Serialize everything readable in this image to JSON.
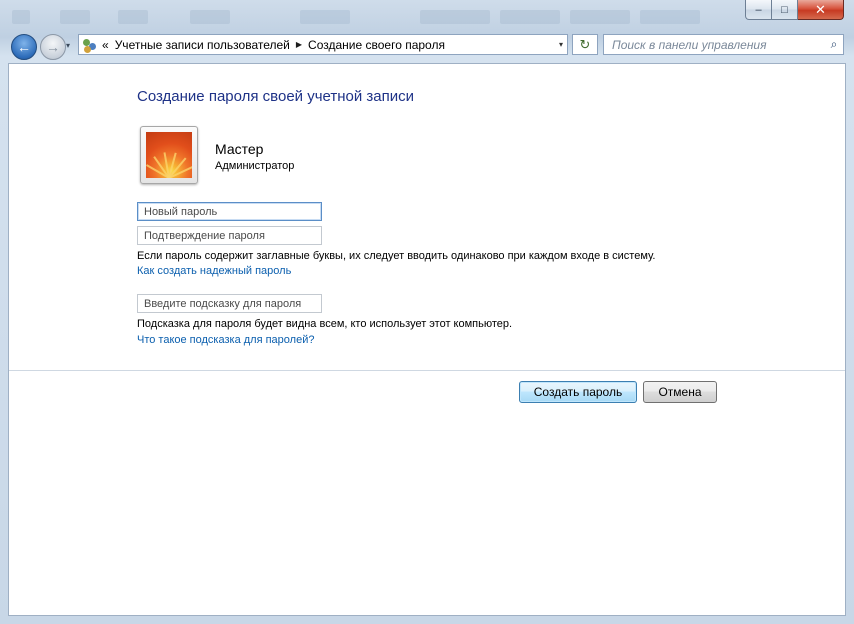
{
  "window": {
    "minimize_glyph": "–",
    "maximize_glyph": "□",
    "close_glyph": "✕"
  },
  "nav": {
    "back_icon": "arrow-left-icon",
    "forward_icon": "arrow-right-icon",
    "back_glyph": "←",
    "forward_glyph": "→",
    "dropdown_glyph": "▾"
  },
  "address": {
    "prefix": "«",
    "crumbs": [
      "Учетные записи пользователей",
      "Создание своего пароля"
    ],
    "separator": "▶",
    "dropdown_glyph": "▾"
  },
  "refresh": {
    "glyph": "↻"
  },
  "search": {
    "placeholder": "Поиск в панели управления",
    "glyph": "⌕"
  },
  "page": {
    "title": "Создание пароля своей учетной записи",
    "user": {
      "name": "Мастер",
      "role": "Администратор"
    },
    "fields": {
      "new_password": "Новый пароль",
      "confirm_password": "Подтверждение пароля",
      "hint": "Введите подсказку для пароля"
    },
    "caps_note": "Если пароль содержит заглавные буквы, их следует вводить одинаково при каждом входе в систему.",
    "strong_password_link": "Как создать надежный пароль",
    "hint_note": "Подсказка для пароля будет видна всем, кто использует этот компьютер.",
    "hint_link": "Что такое подсказка для паролей?",
    "create_button": "Создать пароль",
    "cancel_button": "Отмена"
  },
  "colors": {
    "title": "#1e3287",
    "link": "#0b5fae",
    "pane_bg": "#ffffff",
    "frame": "#cfdcea"
  }
}
